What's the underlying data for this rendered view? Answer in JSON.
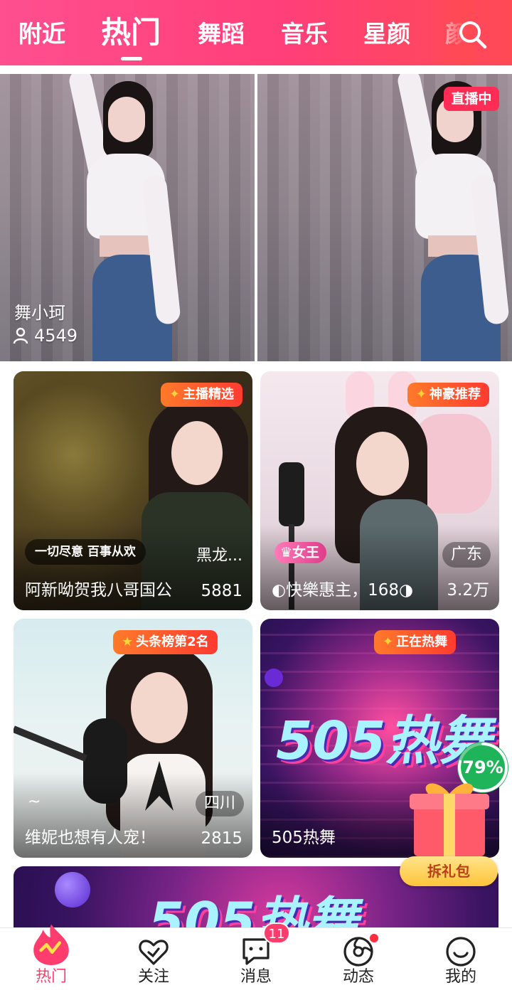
{
  "topbar": {
    "tabs": [
      "附近",
      "热门",
      "舞蹈",
      "音乐",
      "星颜",
      "颜"
    ],
    "active_tab": "热门",
    "icons": {
      "search": "search-icon"
    }
  },
  "hero": {
    "name": "舞小珂",
    "viewers": "4549",
    "live_badge": "直播中"
  },
  "cards": [
    {
      "badge": "主播精选",
      "slogan": "一切尽意 百事从欢",
      "location": "黑龙...",
      "title": "阿新呦贺我八哥国公",
      "count": "5881"
    },
    {
      "badge": "神豪推荐",
      "tag": "女王",
      "location": "广东",
      "title": "◐快樂惠主，168◑",
      "count": "3.2万"
    },
    {
      "badge": "头条榜第2名",
      "location": "四川",
      "extra": "~",
      "title": "维妮也想有人宠！",
      "count": "2815"
    },
    {
      "badge": "正在热舞",
      "promo": "505热舞",
      "title": "505热舞"
    }
  ],
  "promo_banner": {
    "text": "505热舞"
  },
  "gift": {
    "progress_percent": 79,
    "progress_label": "79%",
    "button": "拆礼包"
  },
  "bottom_nav": {
    "items": [
      {
        "label": "热门",
        "icon": "flame-icon",
        "active": true
      },
      {
        "label": "关注",
        "icon": "heart-check-icon"
      },
      {
        "label": "消息",
        "icon": "chat-bubble-icon",
        "badge": "11"
      },
      {
        "label": "动态",
        "icon": "moments-icon",
        "dot": true
      },
      {
        "label": "我的",
        "icon": "smiley-icon"
      }
    ]
  },
  "colors": {
    "accent": "#ff3c6e",
    "live": "#ff2d55",
    "badge_start": "#ff7a2a",
    "badge_end": "#ff3b30"
  }
}
